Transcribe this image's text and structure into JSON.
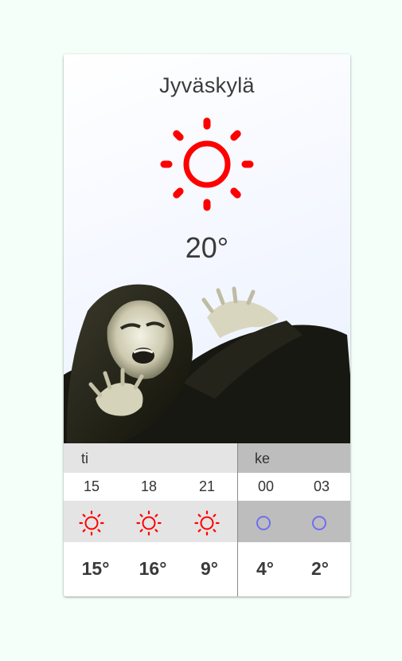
{
  "current": {
    "city": "Jyväskylä",
    "temperature": "20°",
    "icon": "sun-icon",
    "icon_color": "#ff0000"
  },
  "photo": {
    "icon": "person-photo"
  },
  "forecast": {
    "days": [
      {
        "label": "ti",
        "slots": [
          {
            "hour": "15",
            "icon": "sun-icon",
            "temp": "15°"
          },
          {
            "hour": "18",
            "icon": "sun-icon",
            "temp": "16°"
          },
          {
            "hour": "21",
            "icon": "sun-icon",
            "temp": "9°"
          }
        ]
      },
      {
        "label": "ke",
        "slots": [
          {
            "hour": "00",
            "icon": "moon-icon",
            "temp": "4°"
          },
          {
            "hour": "03",
            "icon": "moon-icon",
            "temp": "2°"
          }
        ]
      }
    ]
  },
  "colors": {
    "sun": "#ff0000",
    "moon": "#6f6ff2",
    "background": "#f3fff8"
  }
}
